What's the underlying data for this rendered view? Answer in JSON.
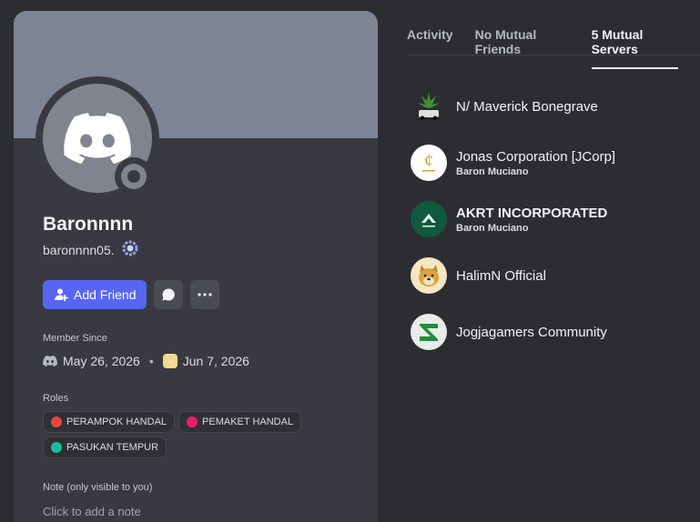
{
  "profile": {
    "display_name": "Baronnnn",
    "username": "baronnnn05.",
    "add_friend_label": "Add Friend",
    "member_since_label": "Member Since",
    "discord_since": "May 26, 2026",
    "server_since": "Jun 7, 2026",
    "roles_label": "Roles",
    "roles": [
      {
        "name": "PERAMPOK HANDAL",
        "color": "#e8453c"
      },
      {
        "name": "PEMAKET HANDAL",
        "color": "#e91e63"
      },
      {
        "name": "PASUKAN TEMPUR",
        "color": "#1abc9c"
      }
    ],
    "note_label": "Note (only visible to you)",
    "note_placeholder": "Click to add a note"
  },
  "tabs": [
    {
      "label": "Activity",
      "active": false
    },
    {
      "label": "No Mutual Friends",
      "active": false
    },
    {
      "label": "5 Mutual Servers",
      "active": true
    }
  ],
  "servers": [
    {
      "name": "N/ Maverick Bonegrave",
      "sub": "",
      "icon": "cannabis-car-icon"
    },
    {
      "name": "Jonas Corporation [JCorp]",
      "sub": "Baron Muciano",
      "icon": "jcorp-logo-icon"
    },
    {
      "name": "AKRT INCORPORATED",
      "sub": "Baron Muciano",
      "icon": "akrt-logo-icon"
    },
    {
      "name": "HalimN Official",
      "sub": "",
      "icon": "doge-icon"
    },
    {
      "name": "Jogjagamers Community",
      "sub": "",
      "icon": "jg-logo-icon"
    }
  ],
  "colors": {
    "accent": "#5865f2",
    "banner": "#7d8595",
    "card": "#393a41",
    "background": "#2b2d31"
  }
}
